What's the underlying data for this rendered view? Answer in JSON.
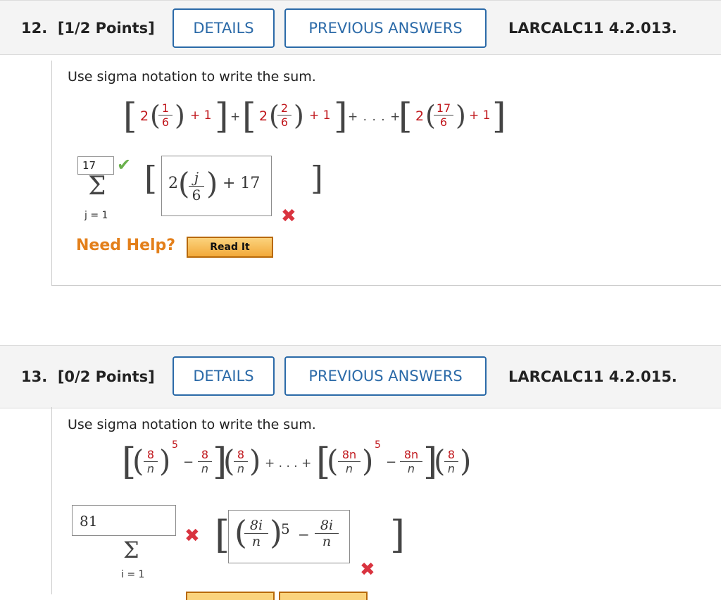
{
  "q12": {
    "number": "12.",
    "points": "[1/2 Points]",
    "details_label": "DETAILS",
    "previous_label": "PREVIOUS ANSWERS",
    "problem_id": "LARCALC11 4.2.013.",
    "prompt": "Use sigma notation to write the sum.",
    "sum_terms": {
      "coef": "2",
      "n1": "1",
      "n2": "2",
      "n3": "17",
      "den": "6",
      "plus_one": "+ 1",
      "plus": "+",
      "ellipsis": "+ . . . +"
    },
    "upper_limit_value": "17",
    "lower_limit": "j = 1",
    "answer_expr": {
      "coef": "2",
      "num": "j",
      "den": "6",
      "tail": "+ 17"
    },
    "need_help": "Need Help?",
    "read_it": "Read It"
  },
  "q13": {
    "number": "13.",
    "points": "[0/2 Points]",
    "details_label": "DETAILS",
    "previous_label": "PREVIOUS ANSWERS",
    "problem_id": "LARCALC11 4.2.015.",
    "prompt": "Use sigma notation to write the sum.",
    "sum_terms": {
      "a": "8",
      "n": "n",
      "exp": "5",
      "minus": "−",
      "an": "8n",
      "ellipsis": "+ . . . +"
    },
    "upper_limit_value": "81",
    "lower_limit": "i = 1",
    "answer_expr": {
      "num": "8i",
      "den": "n",
      "exp": "5",
      "minus": "−"
    }
  },
  "colors": {
    "accent_blue": "#2b6aa8",
    "red": "#c0161b",
    "help_orange": "#e37f1a",
    "check_green": "#6ab04c",
    "x_red": "#d9333f"
  }
}
